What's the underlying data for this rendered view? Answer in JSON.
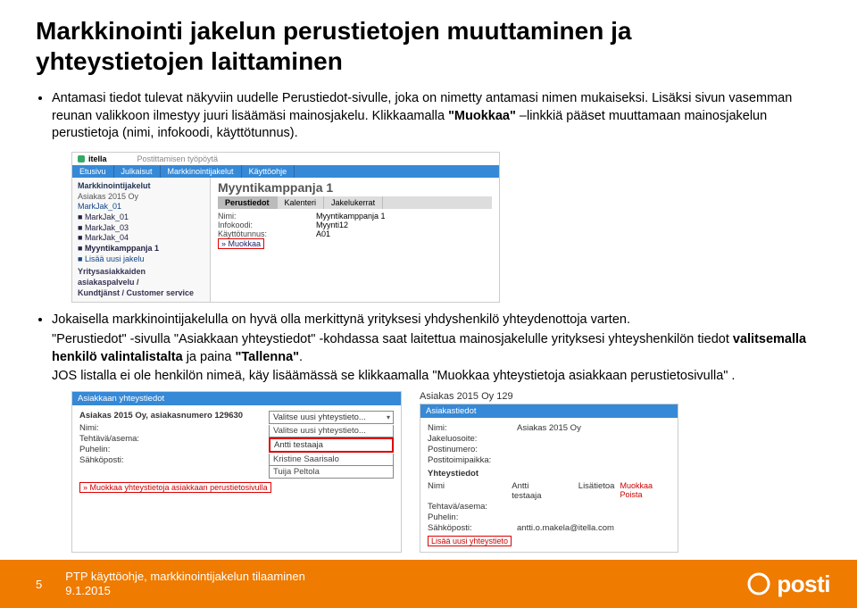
{
  "title_line1": "Markkinointi jakelun perustietojen muuttaminen ja",
  "title_line2": "yhteystietojen laittaminen",
  "bullets": {
    "b1a": "Antamasi tiedot tulevat näkyviin uudelle Perustiedot-sivulle, joka on nimetty antamasi nimen mukaiseksi.",
    "b1b": "Lisäksi sivun vasemman reunan valikkoon ilmestyy juuri lisäämäsi mainosjakelu.",
    "b1c_pre": "Klikkaamalla ",
    "b1c_bold": "\"Muokkaa\"",
    "b1c_post": " –linkkiä pääset muuttamaan mainosjakelun perustietoja (nimi, infokoodi, käyttötunnus).",
    "b2": "Jokaisella markkinointijakelulla on hyvä olla merkittynä yrityksesi yhdyshenkilö yhteydenottoja varten.",
    "b3_pre": "\"Perustiedot\" -sivulla \"Asiakkaan yhteystiedot\" -kohdassa saat laitettua mainosjakelulle yrityksesi yhteyshenkilön tiedot ",
    "b3_bold1": "valitsemalla henkilö valintalistalta",
    "b3_mid": " ja paina ",
    "b3_bold2": "\"Tallenna\"",
    "b3_end": ".",
    "b4": "JOS listalla ei ole henkilön nimeä, käy lisäämässä se klikkaamalla \"Muokkaa yhteystietoja asiakkaan perustietosivulla\" ."
  },
  "shot1": {
    "brand": "itella",
    "posti_label": "Postittamisen työpöytä",
    "tabs": [
      "Etusivu",
      "Julkaisut",
      "Markkinointijakelut",
      "Käyttöohje"
    ],
    "side_hdr": "Markkinointijakelut",
    "side_sub": "Asiakas 2015 Oy",
    "side_items": [
      "MarkJak_01",
      "MarkJak_03",
      "MarkJak_04",
      "Myyntikamppanja 1"
    ],
    "side_add": "Lisää uusi jakelu",
    "side_foot1": "Yritysasiakkaiden asiakaspalvelu /",
    "side_foot2": "Kundtjänst / Customer service",
    "main_title": "Myyntikamppanja 1",
    "sub_tabs": [
      "Perustiedot",
      "Kalenteri",
      "Jakelukerrat"
    ],
    "f_nimi_k": "Nimi:",
    "f_nimi_v": "Myyntikamppanja 1",
    "f_info_k": "Infokoodi:",
    "f_info_v": "Myynti12",
    "f_kt_k": "Käyttötunnus:",
    "f_kt_v": "A01",
    "muokkaa": "» Muokkaa"
  },
  "shot2a": {
    "bar": "Asiakkaan yhteystiedot",
    "hdr": "Asiakas 2015 Oy, asiakasnumero 129630",
    "nimi": "Nimi:",
    "tehtava": "Tehtävä/asema:",
    "puhelin": "Puhelin:",
    "sahkoposti": "Sähköposti:",
    "dd0": "Valitse uusi yhteystieto...",
    "dd1": "Valitse uusi yhteystieto...",
    "dd2": "Antti testaaja",
    "dd3": "Kristine Saarisalo",
    "dd4": "Tuija Peltola",
    "link": "» Muokkaa yhteystietoja asiakkaan perustietosivulla"
  },
  "shot2b": {
    "top": "Asiakas 2015 Oy 129",
    "bar": "Asiakastiedot",
    "nimi_k": "Nimi:",
    "nimi_v": "Asiakas 2015 Oy",
    "jak_k": "Jakeluosoite:",
    "postin_k": "Postinumero:",
    "postitmp_k": "Postitoimipaikka:",
    "yht_hdr": "Yhteystiedot",
    "col_nimi": "Nimi",
    "col_v1": "Antti testaaja",
    "col_lis": "Lisätietoa",
    "col_end": "Muokkaa Poista",
    "tehtava": "Tehtavä/asema:",
    "puhelin": "Puhelin:",
    "sahkoposti": "Sähköposti:",
    "sahkoposti_v": "antti.o.makela@itella.com",
    "link": "Lisää uusi yhteystieto"
  },
  "footer": {
    "page": "5",
    "line1": "PTP käyttöohje, markkinointijakelun tilaaminen",
    "line2": "9.1.2015",
    "logo_text": "posti"
  }
}
